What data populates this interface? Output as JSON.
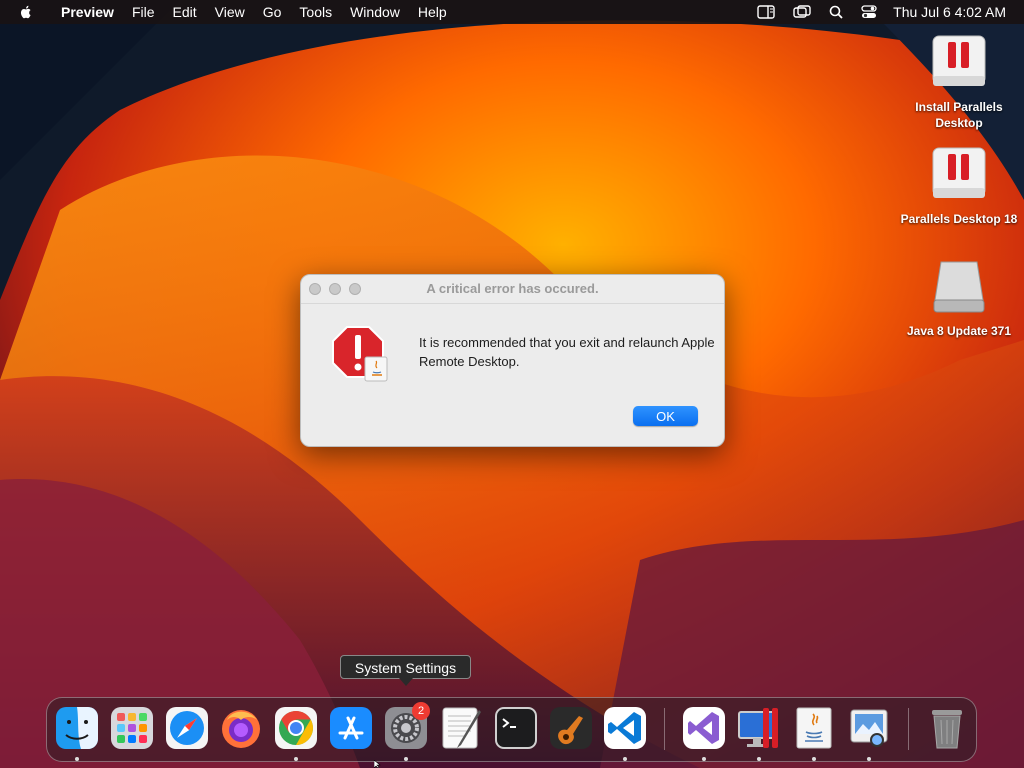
{
  "menubar": {
    "app_name": "Preview",
    "items": [
      "File",
      "Edit",
      "View",
      "Go",
      "Tools",
      "Window",
      "Help"
    ],
    "clock": "Thu Jul 6  4:02 AM"
  },
  "desktop_icons": [
    {
      "label": "Install Parallels Desktop"
    },
    {
      "label": "Parallels Desktop 18"
    },
    {
      "label": "Java 8 Update 371"
    }
  ],
  "dialog": {
    "title": "A critical error has occured.",
    "message": "It is recommended that you exit and relaunch Apple Remote Desktop.",
    "ok_label": "OK"
  },
  "tooltip": {
    "text": "System Settings"
  },
  "dock": {
    "settings_badge": "2",
    "items": [
      "finder-icon",
      "launchpad-icon",
      "safari-icon",
      "firefox-icon",
      "chrome-icon",
      "app-store-icon",
      "system-settings-icon",
      "textedit-icon",
      "terminal-icon",
      "garageband-icon",
      "vscode-icon",
      "visual-studio-icon",
      "parallels-icon",
      "java-icon",
      "preview-icon",
      "trash-icon"
    ]
  }
}
